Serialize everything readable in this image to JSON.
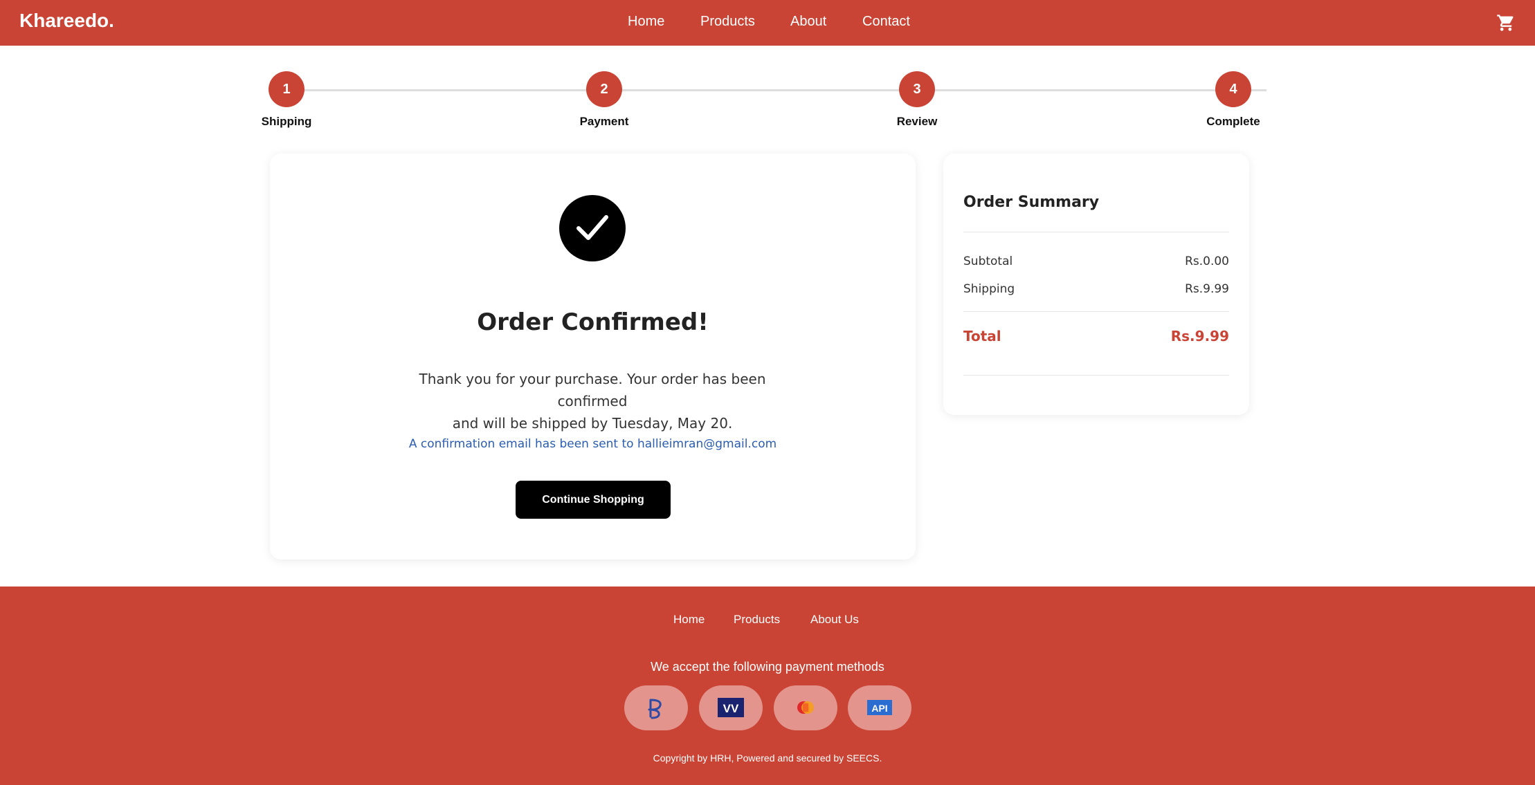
{
  "header": {
    "logo": "Khareedo.",
    "nav": [
      "Home",
      "Products",
      "About",
      "Contact"
    ],
    "cart_icon": "cart-icon"
  },
  "stepper": {
    "steps": [
      {
        "number": "1",
        "label": "Shipping"
      },
      {
        "number": "2",
        "label": "Payment"
      },
      {
        "number": "3",
        "label": "Review"
      },
      {
        "number": "4",
        "label": "Complete"
      }
    ]
  },
  "confirmation": {
    "icon": "checkmark-icon",
    "title": "Order Confirmed!",
    "message_line1": "Thank you for your purchase. Your order has been confirmed",
    "message_line2": "and will be shipped by Tuesday, May 20.",
    "email_note": "A confirmation email has been sent to hallieimran@gmail.com",
    "continue_label": "Continue Shopping"
  },
  "summary": {
    "title": "Order Summary",
    "subtotal_label": "Subtotal",
    "subtotal_value": "Rs.0.00",
    "shipping_label": "Shipping",
    "shipping_value": "Rs.9.99",
    "total_label": "Total",
    "total_value": "Rs.9.99"
  },
  "footer": {
    "nav": [
      "Home",
      "Products",
      "About Us"
    ],
    "payment_text": "We accept the following payment methods",
    "payment_icons": [
      "paypal-icon",
      "visa-icon",
      "mastercard-icon",
      "api-icon"
    ],
    "copyright": "Copyright by HRH, Powered and secured by SEECS."
  },
  "colors": {
    "brand": "#c94434",
    "email_link": "#2a5db0",
    "button": "#000000"
  }
}
